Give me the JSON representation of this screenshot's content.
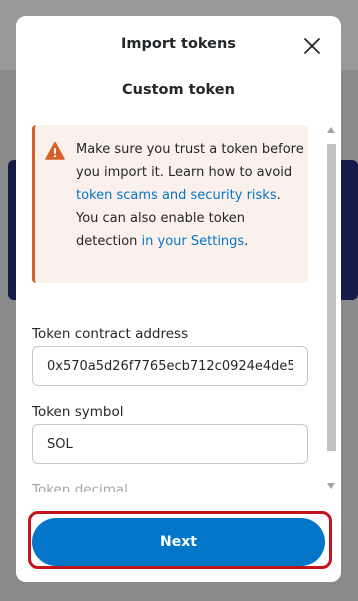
{
  "modal": {
    "title": "Import tokens",
    "tab_title": "Custom token"
  },
  "warning": {
    "text_before": "Make sure you trust a token before you import it. Learn how to avoid ",
    "scam_link": "token scams and security risks",
    "text_middle": ". You can also enable token detection ",
    "settings_link": "in your Settings",
    "text_after": "."
  },
  "fields": {
    "contract_label": "Token contract address",
    "contract_value": "0x570a5d26f7765ecb712c0924e4de5",
    "symbol_label": "Token symbol",
    "symbol_value": "SOL",
    "decimal_label": "Token decimal"
  },
  "footer": {
    "next_label": "Next"
  },
  "colors": {
    "accent": "#0376c9",
    "warning_border": "#d7602a",
    "warning_bg": "#fbf1ec",
    "highlight": "#c4141b"
  },
  "icons": {
    "close": "close-icon",
    "warning": "warning-icon"
  }
}
